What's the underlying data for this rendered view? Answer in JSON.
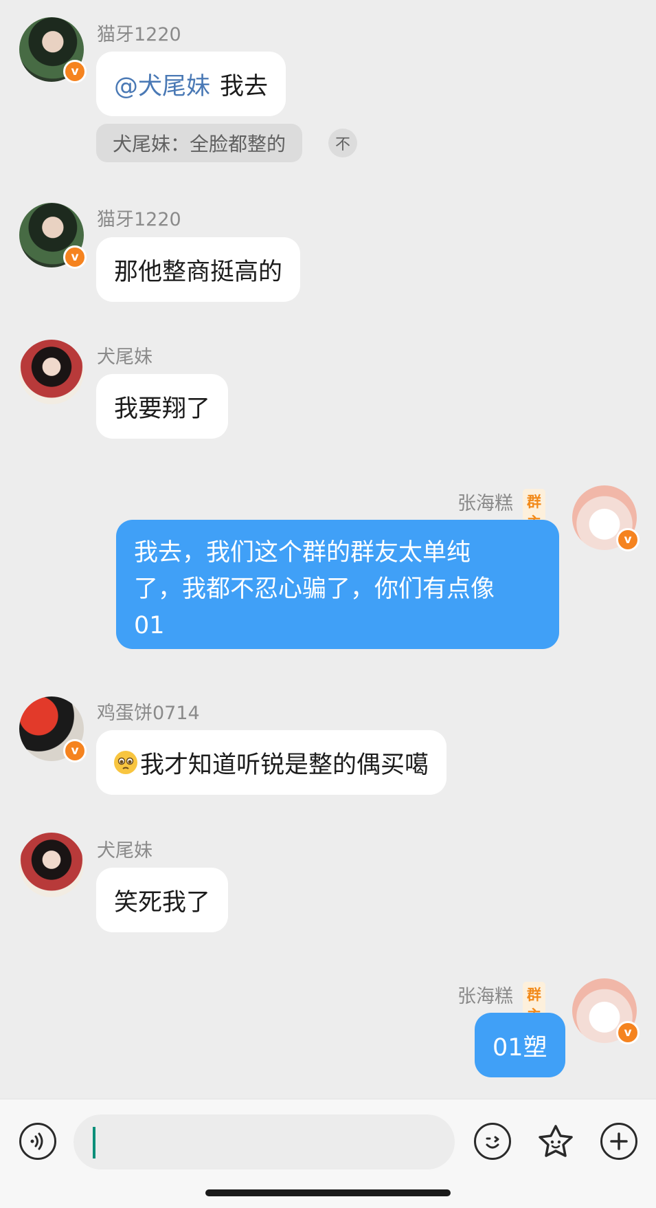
{
  "messages": [
    {
      "sender": "猫牙1220",
      "mention": "@犬尾妹",
      "text": "我去",
      "quote": {
        "text": "犬尾妹：全脸都整的",
        "button": "不"
      }
    },
    {
      "sender": "猫牙1220",
      "text": "那他整商挺高的"
    },
    {
      "sender": "犬尾妹",
      "text": "我要翔了"
    },
    {
      "sender": "张海糕",
      "tag": "群主",
      "lines": [
        "我去，我们这个群的群友太单纯",
        "了，我都不忍心骗了，你们有点像",
        "01"
      ]
    },
    {
      "sender": "鸡蛋饼0714",
      "text": "我才知道听锐是整的偶买噶",
      "emoji": "pleading-face-emoji"
    },
    {
      "sender": "犬尾妹",
      "text": "笑死我了"
    },
    {
      "sender": "张海糕",
      "tag": "群主",
      "text": "01塑"
    }
  ],
  "badge_text": "v",
  "input": {
    "value": ""
  },
  "icons": {
    "voice": "voice-icon",
    "emoji": "emoji-icon",
    "sticker": "sticker-icon",
    "plus": "plus-icon"
  },
  "colors": {
    "background": "#ededed",
    "my_bubble": "#40a0f7",
    "their_bubble": "#ffffff",
    "verified_badge": "#f5831f",
    "owner_tag": "#f28a1a",
    "mention": "#4a79b5"
  }
}
